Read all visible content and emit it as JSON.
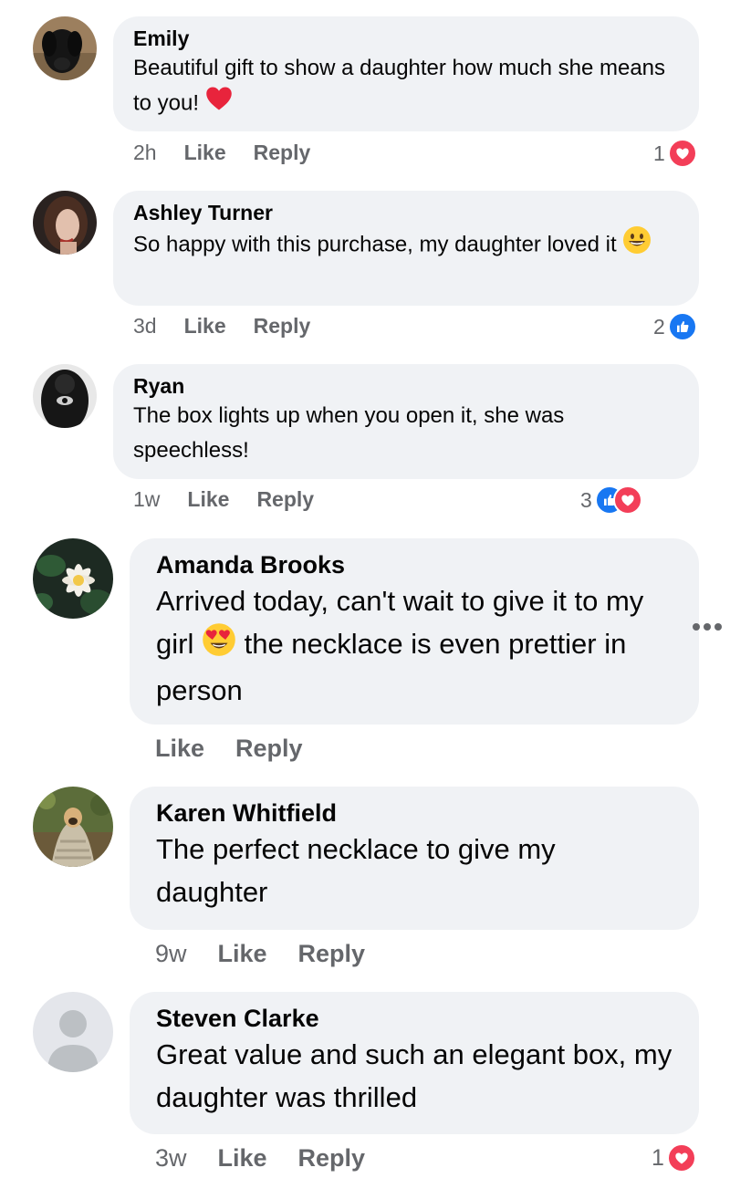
{
  "comments": [
    {
      "author": "Emily",
      "text_before": "Beautiful gift to show a daughter how much she means to you!",
      "emoji": "heart-emoji",
      "text_after": "",
      "time": "2h",
      "like_label": "Like",
      "reply_label": "Reply",
      "reaction_count": "1",
      "reactions": [
        "love"
      ]
    },
    {
      "author": "Ashley Turner",
      "text_before": "So happy with this purchase, my daughter loved it",
      "emoji": "grinning-face-emoji",
      "text_after": "",
      "time": "3d",
      "like_label": "Like",
      "reply_label": "Reply",
      "reaction_count": "2",
      "reactions": [
        "like"
      ]
    },
    {
      "author": "Ryan",
      "text_before": "The box lights up when you open it, she was speechless!",
      "emoji": "",
      "text_after": "",
      "time": "1w",
      "like_label": "Like",
      "reply_label": "Reply",
      "reaction_count": "3",
      "reactions": [
        "like",
        "love"
      ]
    },
    {
      "author": "Amanda Brooks",
      "text_before": "Arrived today, can't wait to give it to my girl",
      "emoji": "heart-eyes-emoji",
      "text_after": "the necklace is even prettier in person",
      "time": "",
      "like_label": "Like",
      "reply_label": "Reply",
      "reaction_count": "",
      "reactions": []
    },
    {
      "author": "Karen Whitfield",
      "text_before": "The perfect necklace to give my daughter",
      "emoji": "",
      "text_after": "",
      "time": "9w",
      "like_label": "Like",
      "reply_label": "Reply",
      "reaction_count": "",
      "reactions": []
    },
    {
      "author": "Steven Clarke",
      "text_before": "Great value and such an elegant box, my daughter was thrilled",
      "emoji": "",
      "text_after": "",
      "time": "3w",
      "like_label": "Like",
      "reply_label": "Reply",
      "reaction_count": "1",
      "reactions": [
        "love"
      ]
    }
  ],
  "colors": {
    "bubble": "#f0f2f5",
    "meta_text": "#65676b",
    "like_blue": "#1877f2",
    "love_red": "#f33e58"
  },
  "icons": {
    "more": "more-options-icon"
  }
}
